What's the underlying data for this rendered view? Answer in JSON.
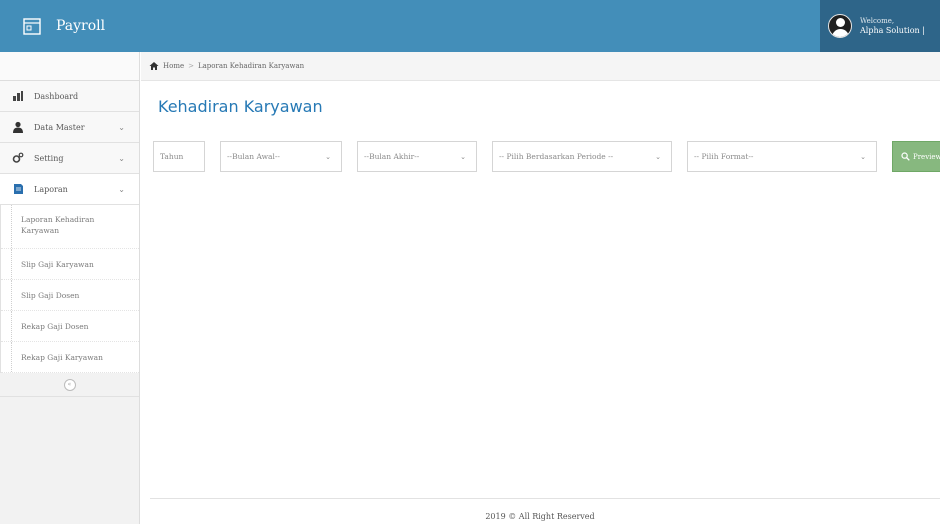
{
  "header": {
    "brand": "Payroll",
    "user_welcome": "Welcome,",
    "user_name": "Alpha Solution |"
  },
  "sidebar": {
    "items": [
      {
        "label": "Dashboard",
        "icon": "dashboard-icon"
      },
      {
        "label": "Data Master",
        "icon": "user-icon"
      },
      {
        "label": "Setting",
        "icon": "gears-icon"
      },
      {
        "label": "Laporan",
        "icon": "report-icon"
      }
    ],
    "submenu": [
      "Laporan Kehadiran Karyawan",
      "Slip Gaji Karyawan",
      "Slip Gaji Dosen",
      "Rekap Gaji Dosen",
      "Rekap Gaji Karyawan"
    ],
    "collapse_icon": "double-chevron-left-icon"
  },
  "breadcrumb": {
    "home": "Home",
    "current": "Laporan Kehadiran Karyawan"
  },
  "page_title": "Kehadiran Karyawan",
  "filters": {
    "tahun_placeholder": "Tahun",
    "bulan_awal": "--Bulan Awal--",
    "bulan_akhir": "--Bulan Akhir--",
    "periode": "-- Pilih Berdasarkan Periode --",
    "format": "-- Pilih Format--",
    "search_label": "Preview"
  },
  "footer": {
    "text": "2019 © All Right Reserved"
  },
  "colors": {
    "navbar": "#438eb9",
    "title": "#2679b5",
    "search_button": "#87b87f"
  }
}
